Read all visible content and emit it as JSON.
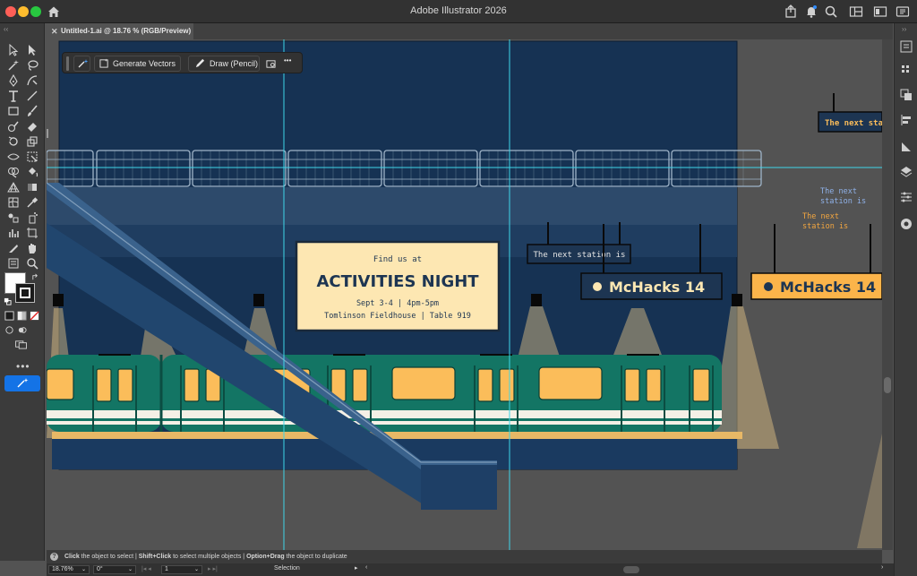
{
  "app": {
    "title": "Adobe Illustrator 2026",
    "document_tab": "Untitled-1.ai @ 18.76 % (RGB/Preview)",
    "tab_close": "✕"
  },
  "taskbar": {
    "generate_label": "Generate Vectors",
    "draw_label": "Draw (Pencil)",
    "more": "•••"
  },
  "artwork": {
    "poster_line1": "Find us at",
    "poster_title": "ACTIVITIES NIGHT",
    "poster_line2": "Sept 3-4 | 4pm-5pm",
    "poster_line3": "Tomlinson Fieldhouse | Table 919",
    "sign_next_station": "The next station is",
    "sign_mchacks": "McHacks 14",
    "sign_next_sta_clipped": "The next sta",
    "text_blue_1": "The next",
    "text_blue_2": "station is",
    "text_orange_1": "The next",
    "text_orange_2": "station is"
  },
  "hint": {
    "k1": "Click",
    "t1": " the object to select  |  ",
    "k2": "Shift+Click",
    "t2": " to select multiple objects  |  ",
    "k3": "Option+Drag",
    "t3": " the object to duplicate"
  },
  "status": {
    "zoom": "18.76%",
    "rotation": "0°",
    "artboard": "1",
    "tool": "Selection"
  },
  "left_toolbar": {
    "collapse": "‹‹",
    "more": "•••"
  },
  "colors": {
    "night_sky": "#163253",
    "train_teal": "#137564",
    "window_amber": "#fbbd5a",
    "poster_bg": "#fde7b2",
    "guide_cyan": "#3fd6e8",
    "accent_blue": "#1473e6"
  }
}
